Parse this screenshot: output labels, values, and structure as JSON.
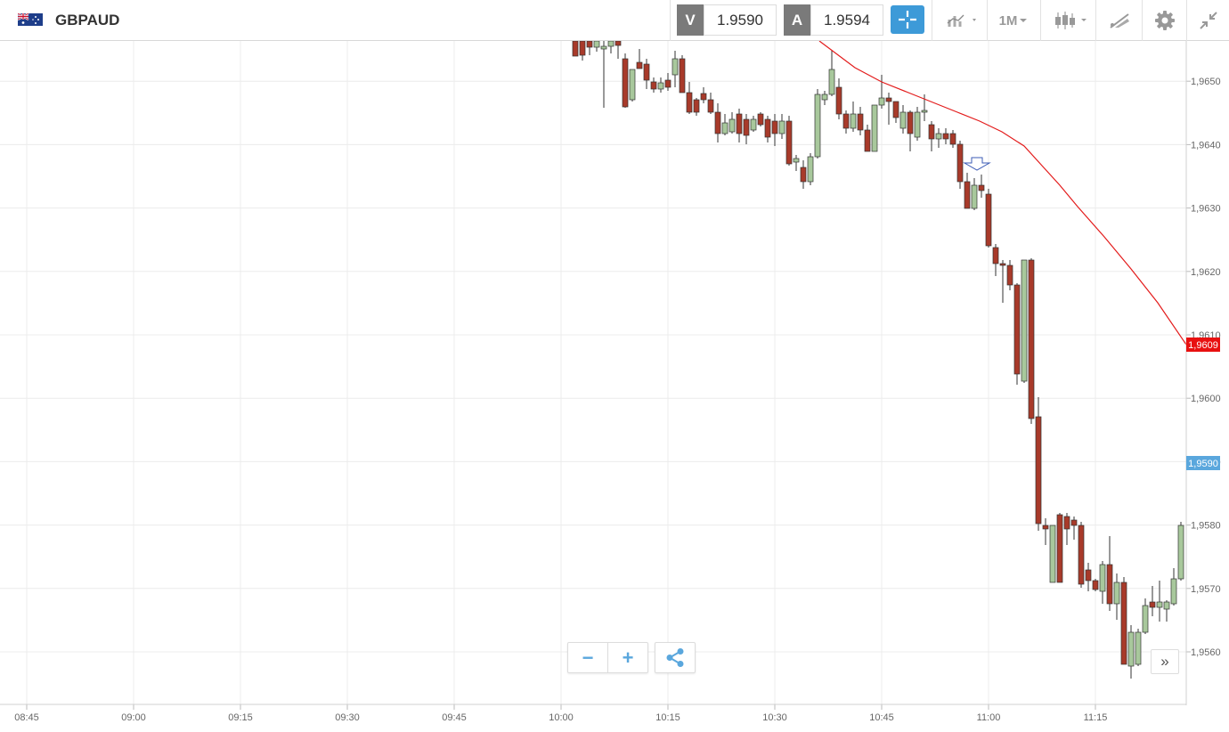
{
  "instrument": {
    "symbol": "GBPAUD",
    "flag_icon": "uk-australia-flag-icon"
  },
  "prices": {
    "bid_label": "V",
    "bid_value": "1.9590",
    "ask_label": "A",
    "ask_value": "1.9594"
  },
  "toolbar": {
    "crosshair_icon": "crosshair-icon",
    "indicators_icon": "indicators-icon",
    "timeframe_label": "1M",
    "chart_type_icon": "candlestick-icon",
    "drawing_icon": "drawing-tools-icon",
    "settings_icon": "gear-icon",
    "collapse_icon": "collapse-icon"
  },
  "chart": {
    "y_ticks": [
      "1,9560",
      "1,9570",
      "1,9580",
      "1,9590",
      "1,9600",
      "1,9610",
      "1,9620",
      "1,9630",
      "1,9640",
      "1,9650"
    ],
    "x_ticks": [
      "08:45",
      "09:00",
      "09:15",
      "09:30",
      "09:45",
      "10:00",
      "10:15",
      "10:30",
      "10:45",
      "11:00",
      "11:15"
    ],
    "ma_marker_label": "1,9609",
    "bid_marker_label": "1,9590",
    "colors": {
      "up": "#a8c89c",
      "down": "#a83a2a",
      "ma": "#e31b1b",
      "ma_marker": "#e81010",
      "bid_marker": "#5aa7dd",
      "accent": "#3d9ad8"
    }
  },
  "controls": {
    "zoom_out_label": "−",
    "zoom_in_label": "+",
    "share_icon": "share-icon",
    "more_label": "»"
  }
}
